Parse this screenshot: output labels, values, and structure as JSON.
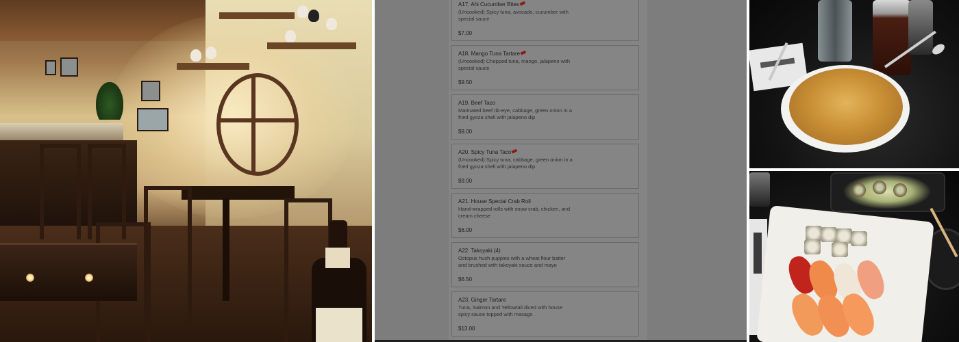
{
  "menu": {
    "items": [
      {
        "name": "A17. Ahi Cucumber Bites",
        "spicy": true,
        "description": "(Uncooked) Spicy tuna, avocado, cucumber with special sauce",
        "price": "$7.00"
      },
      {
        "name": "A18. Mango Tuna Tartare",
        "spicy": true,
        "description": "(Uncooked) Chopped tuna, mango, jalapeno with special sauce",
        "price": "$9.50"
      },
      {
        "name": "A19. Beef Taco",
        "spicy": false,
        "description": "Marinated beef rib-eye, cabbage, green onion in a fried gyoza shell with jalapeno dip",
        "price": "$9.00"
      },
      {
        "name": "A20. Spicy Tuna Taco",
        "spicy": true,
        "description": "(Uncooked) Spicy tuna, cabbage, green onion in a fried gyoza shell with jalapeno dip",
        "price": "$9.00"
      },
      {
        "name": "A21. House Special Crab Roll",
        "spicy": false,
        "description": "Hand-wrapped rolls with snow crab, chicken, and cream cheese",
        "price": "$6.00"
      },
      {
        "name": "A22. Takoyaki (4)",
        "spicy": false,
        "description": "Octopus hush puppies with a wheat flour batter and brushed with takoyaki sauce and mayo",
        "price": "$6.50"
      },
      {
        "name": "A23. Ginger Tartare",
        "spicy": false,
        "description": "Tuna, Salmon and Yellowtail diced with house spicy sauce topped with masago",
        "price": "$13.00"
      }
    ]
  },
  "icons": {
    "spicy": "chili-pepper-icon"
  },
  "colors": {
    "overlay": "#7d7d7d",
    "card": "#858585",
    "card_border": "#6a6a6a",
    "text": "#1e1e1e",
    "pepper": "#8a1c14"
  }
}
